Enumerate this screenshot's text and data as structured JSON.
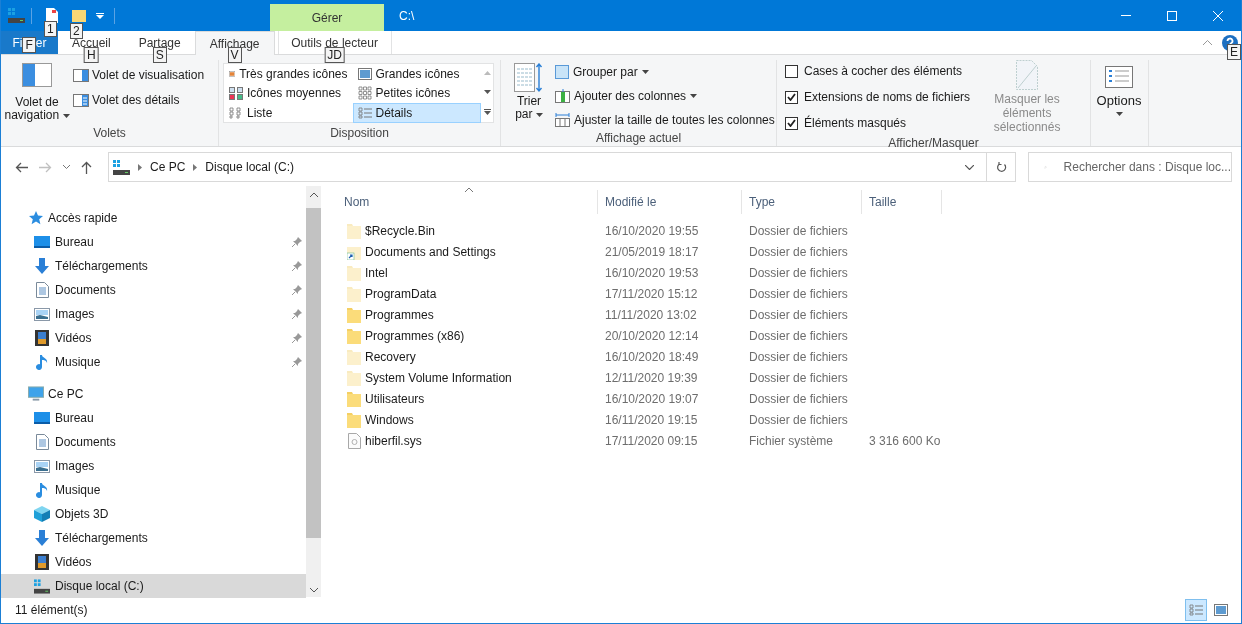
{
  "quick_access": {
    "keytips": [
      "1",
      "2"
    ]
  },
  "title_bar": {
    "context_tab": "Gérer",
    "title": "C:\\"
  },
  "ribbon_tabs": [
    {
      "kind": "file",
      "label_start": "Fi",
      "label_end": "er",
      "keytip": "F",
      "selected": false
    },
    {
      "kind": "normal",
      "label": "Accueil",
      "keytip": "H",
      "selected": false
    },
    {
      "kind": "normal",
      "label": "Partage",
      "keytip": "S",
      "selected": false
    },
    {
      "kind": "normal",
      "label": "Affichage",
      "keytip": "V",
      "selected": true
    },
    {
      "kind": "contextual",
      "label": "Outils de lecteur",
      "keytip": "JD",
      "selected": false
    }
  ],
  "help_keytip": "E",
  "ribbon": {
    "panes": {
      "label": "Volets",
      "navigation_pane": "Volet de navigation",
      "preview_pane": "Volet de visualisation",
      "details_pane": "Volet des détails"
    },
    "layout": {
      "label": "Disposition",
      "items": [
        {
          "label": "Très grandes icônes",
          "kind": "xl",
          "selected": false
        },
        {
          "label": "Grandes icônes",
          "kind": "large",
          "selected": false
        },
        {
          "label": "Icônes moyennes",
          "kind": "medium",
          "selected": false
        },
        {
          "label": "Petites icônes",
          "kind": "small",
          "selected": false
        },
        {
          "label": "Liste",
          "kind": "list",
          "selected": false
        },
        {
          "label": "Détails",
          "kind": "details",
          "selected": true
        }
      ]
    },
    "current_view": {
      "label": "Affichage actuel",
      "sort_by": "Trier par",
      "group_by": "Grouper par",
      "add_columns": "Ajouter des colonnes",
      "size_columns": "Ajuster la taille de toutes les colonnes"
    },
    "show_hide": {
      "label": "Afficher/Masquer",
      "checkboxes": [
        {
          "label": "Cases à cocher des éléments",
          "checked": false
        },
        {
          "label": "Extensions de noms de fichiers",
          "checked": true
        },
        {
          "label": "Éléments masqués",
          "checked": true
        }
      ],
      "hide_selected": {
        "label": "Masquer les éléments sélectionnés",
        "disabled": true
      }
    },
    "options": {
      "label": "Options"
    }
  },
  "address": {
    "breadcrumbs": [
      "Ce PC",
      "Disque local (C:)"
    ],
    "search_placeholder": "Rechercher dans : Disque loc..."
  },
  "navigation": [
    {
      "label": "Accès rapide",
      "kind": "star",
      "selected": false,
      "children": [
        {
          "label": "Bureau",
          "kind": "desktop",
          "selected": false,
          "pinned": true
        },
        {
          "label": "Téléchargements",
          "kind": "download",
          "selected": false,
          "pinned": true
        },
        {
          "label": "Documents",
          "kind": "documents",
          "selected": false,
          "pinned": true
        },
        {
          "label": "Images",
          "kind": "pictures",
          "selected": false,
          "pinned": true
        },
        {
          "label": "Vidéos",
          "kind": "videos",
          "selected": false,
          "pinned": true
        },
        {
          "label": "Musique",
          "kind": "music",
          "selected": false,
          "pinned": true
        }
      ]
    },
    {
      "label": "Ce PC",
      "kind": "pc",
      "selected": false,
      "children": [
        {
          "label": "Bureau",
          "kind": "desktop",
          "selected": false,
          "pinned": false
        },
        {
          "label": "Documents",
          "kind": "documents",
          "selected": false,
          "pinned": false
        },
        {
          "label": "Images",
          "kind": "pictures",
          "selected": false,
          "pinned": false
        },
        {
          "label": "Musique",
          "kind": "music",
          "selected": false,
          "pinned": false
        },
        {
          "label": "Objets 3D",
          "kind": "objects3d",
          "selected": false,
          "pinned": false
        },
        {
          "label": "Téléchargements",
          "kind": "download",
          "selected": false,
          "pinned": false
        },
        {
          "label": "Vidéos",
          "kind": "videos",
          "selected": false,
          "pinned": false
        },
        {
          "label": "Disque local (C:)",
          "kind": "drive",
          "selected": true,
          "pinned": false
        }
      ]
    }
  ],
  "table": {
    "columns": [
      {
        "label": "Nom",
        "sorted": true
      },
      {
        "label": "Modifié le",
        "sorted": false
      },
      {
        "label": "Type",
        "sorted": false
      },
      {
        "label": "Taille",
        "sorted": false
      }
    ],
    "rows": [
      {
        "kind": "hidden_folder",
        "name": "$Recycle.Bin",
        "modified": "16/10/2020 19:55",
        "type": "Dossier de fichiers"
      },
      {
        "kind": "shortcut",
        "name": "Documents and Settings",
        "modified": "21/05/2019 18:17",
        "type": "Dossier de fichiers"
      },
      {
        "kind": "hidden_folder",
        "name": "Intel",
        "modified": "16/10/2020 19:53",
        "type": "Dossier de fichiers"
      },
      {
        "kind": "hidden_folder",
        "name": "ProgramData",
        "modified": "17/11/2020 15:12",
        "type": "Dossier de fichiers"
      },
      {
        "kind": "folder",
        "name": "Programmes",
        "modified": "11/11/2020 13:02",
        "type": "Dossier de fichiers"
      },
      {
        "kind": "folder",
        "name": "Programmes (x86)",
        "modified": "20/10/2020 12:14",
        "type": "Dossier de fichiers"
      },
      {
        "kind": "hidden_folder",
        "name": "Recovery",
        "modified": "16/10/2020 18:49",
        "type": "Dossier de fichiers"
      },
      {
        "kind": "hidden_folder",
        "name": "System Volume Information",
        "modified": "12/11/2020 19:39",
        "type": "Dossier de fichiers"
      },
      {
        "kind": "folder",
        "name": "Utilisateurs",
        "modified": "16/10/2020 19:07",
        "type": "Dossier de fichiers"
      },
      {
        "kind": "folder",
        "name": "Windows",
        "modified": "16/11/2020 19:15",
        "type": "Dossier de fichiers"
      },
      {
        "kind": "system_file",
        "name": "hiberfil.sys",
        "modified": "17/11/2020 09:15",
        "type": "Fichier système",
        "size": "3 316 600 Ko"
      }
    ]
  },
  "status_bar": {
    "count": "11 élément(s)",
    "views": [
      {
        "kind": "details",
        "selected": true
      },
      {
        "kind": "large",
        "selected": false
      }
    ]
  }
}
